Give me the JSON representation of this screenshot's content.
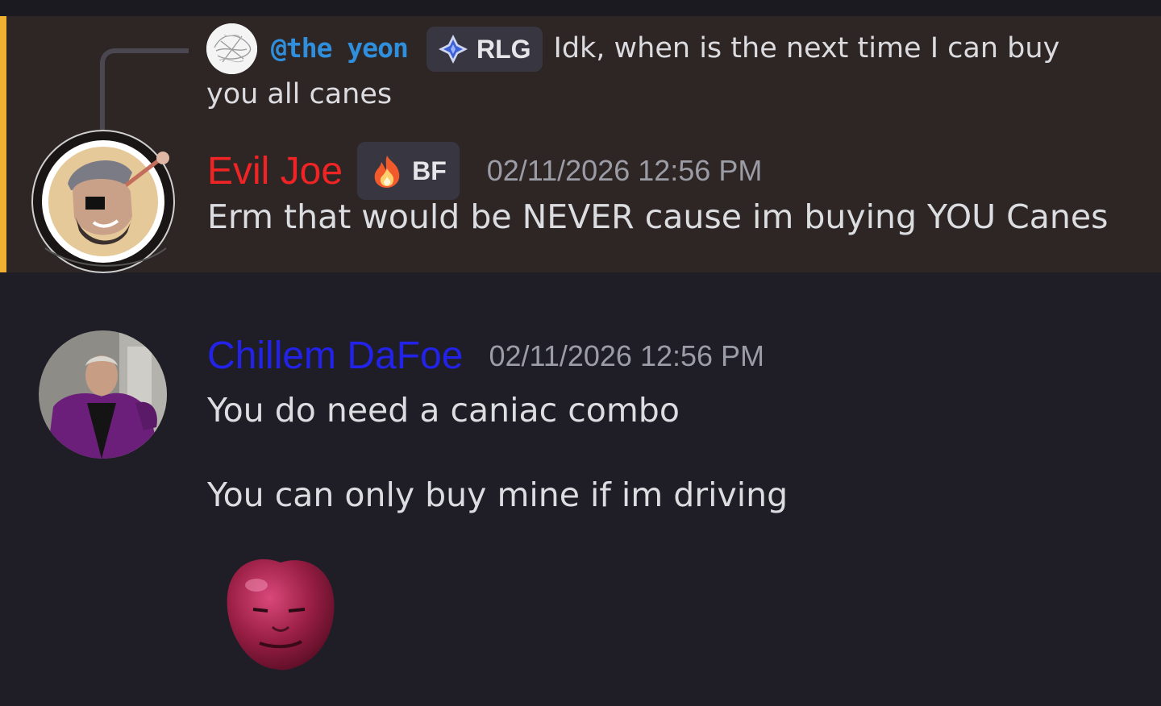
{
  "replied_message": {
    "author": "@the yeon",
    "role_tag": "RLG",
    "text": "Idk, when is the next time I can buy you all canes",
    "avatar_icon": "scribble-avatar-icon"
  },
  "messages": [
    {
      "author": "Evil Joe",
      "author_color": "#f02424",
      "role_tag": "BF",
      "role_icon": "fire-icon",
      "timestamp": "02/11/2026 12:56 PM",
      "text": "Erm that would be NEVER cause im buying YOU Canes",
      "mentions_you": true
    },
    {
      "author": "Chillem DaFoe",
      "author_color": "#2222e8",
      "timestamp": "02/11/2026 12:56 PM",
      "lines": [
        "You do need a caniac combo",
        "You can only buy mine if im driving"
      ],
      "sticker_icon": "apple-face-sticker-icon"
    }
  ],
  "colors": {
    "background": "#1f1e26",
    "highlight": "#2e2625",
    "mention_bar": "#f0b132",
    "reply_author": "#2f8fdc",
    "timestamp": "#9b9ca6"
  }
}
